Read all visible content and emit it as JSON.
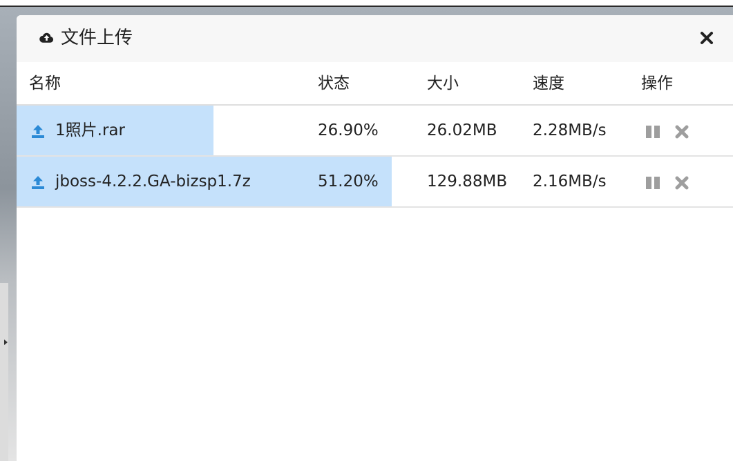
{
  "dialog": {
    "title": "文件上传",
    "title_icon": "cloud-upload-icon",
    "close_icon": "close-icon"
  },
  "table": {
    "columns": {
      "name": "名称",
      "status": "状态",
      "size": "大小",
      "speed": "速度",
      "actions": "操作"
    },
    "rows": [
      {
        "name": "1照片.rar",
        "status": "26.90%",
        "size": "26.02MB",
        "speed": "2.28MB/s",
        "progress": 0.269
      },
      {
        "name": "jboss-4.2.2.GA-bizsp1.7z",
        "status": "51.20%",
        "size": "129.88MB",
        "speed": "2.16MB/s",
        "progress": 0.512
      }
    ]
  },
  "colors": {
    "progress_fill": "#c5e1fb",
    "upload_icon": "#2b8ad6",
    "action_icon": "#9e9e9e"
  }
}
